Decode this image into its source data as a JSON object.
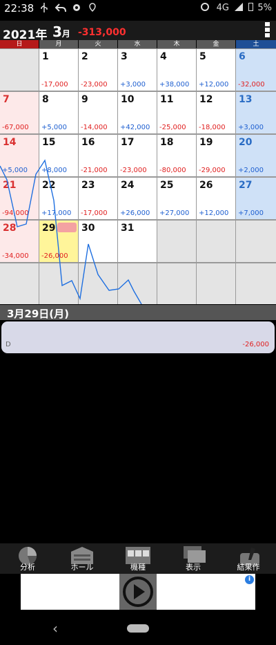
{
  "status_bar": {
    "time": "22:38",
    "network": "4G",
    "battery": "5%",
    "icons": [
      "usb-icon",
      "reply-icon",
      "gear-icon",
      "location-icon",
      "alarm-icon",
      "signal-icon",
      "battery-icon"
    ]
  },
  "header": {
    "year": "2021年",
    "month_num": "3",
    "month_suffix": "月",
    "total": "-313,000"
  },
  "weekdays": [
    "日",
    "月",
    "火",
    "水",
    "木",
    "金",
    "土"
  ],
  "weekday_colors": {
    "sun": "#b51a1a",
    "weekday": "#5a5a5a",
    "sat": "#1f4f96"
  },
  "weeks": [
    [
      {
        "day": "",
        "amount": ""
      },
      {
        "day": "1",
        "amount": "-17,000"
      },
      {
        "day": "2",
        "amount": "-23,000"
      },
      {
        "day": "3",
        "amount": "+3,000"
      },
      {
        "day": "4",
        "amount": "+38,000"
      },
      {
        "day": "5",
        "amount": "+12,000"
      },
      {
        "day": "6",
        "amount": "-32,000"
      }
    ],
    [
      {
        "day": "7",
        "amount": "-67,000"
      },
      {
        "day": "8",
        "amount": "+5,000"
      },
      {
        "day": "9",
        "amount": "-14,000"
      },
      {
        "day": "10",
        "amount": "+42,000"
      },
      {
        "day": "11",
        "amount": "-25,000"
      },
      {
        "day": "12",
        "amount": "-18,000"
      },
      {
        "day": "13",
        "amount": "+3,000"
      }
    ],
    [
      {
        "day": "14",
        "amount": "+5,000"
      },
      {
        "day": "15",
        "amount": "+8,000"
      },
      {
        "day": "16",
        "amount": "-21,000"
      },
      {
        "day": "17",
        "amount": "-23,000"
      },
      {
        "day": "18",
        "amount": "-80,000"
      },
      {
        "day": "19",
        "amount": "-29,000"
      },
      {
        "day": "20",
        "amount": "+2,000"
      }
    ],
    [
      {
        "day": "21",
        "amount": "-94,000"
      },
      {
        "day": "22",
        "amount": "+17,000"
      },
      {
        "day": "23",
        "amount": "-17,000"
      },
      {
        "day": "24",
        "amount": "+26,000"
      },
      {
        "day": "25",
        "amount": "+27,000"
      },
      {
        "day": "26",
        "amount": "+12,000"
      },
      {
        "day": "27",
        "amount": "+7,000"
      }
    ],
    [
      {
        "day": "28",
        "amount": "-34,000"
      },
      {
        "day": "29",
        "amount": "-26,000"
      },
      {
        "day": "30",
        "amount": ""
      },
      {
        "day": "31",
        "amount": ""
      },
      {
        "day": "",
        "amount": ""
      },
      {
        "day": "",
        "amount": ""
      },
      {
        "day": "",
        "amount": ""
      }
    ],
    [
      {
        "day": "",
        "amount": ""
      },
      {
        "day": "",
        "amount": ""
      },
      {
        "day": "",
        "amount": ""
      },
      {
        "day": "",
        "amount": ""
      },
      {
        "day": "",
        "amount": ""
      },
      {
        "day": "",
        "amount": ""
      },
      {
        "day": "",
        "amount": ""
      }
    ]
  ],
  "selected_day": "29",
  "trend_color": "#1e6fe0",
  "selected_date": "3月29日(月)",
  "day_detail": {
    "label": "D",
    "amount": "-26,000"
  },
  "toolbar": [
    {
      "label": "分析",
      "icon": "pie-chart-icon"
    },
    {
      "label": "ホール",
      "icon": "building-icon"
    },
    {
      "label": "機種",
      "icon": "slot-machine-icon"
    },
    {
      "label": "表示",
      "icon": "display-icon"
    },
    {
      "label": "結果作",
      "icon": "pencil-icon"
    }
  ],
  "ad": {
    "icon": "play-icon",
    "info": "i"
  }
}
